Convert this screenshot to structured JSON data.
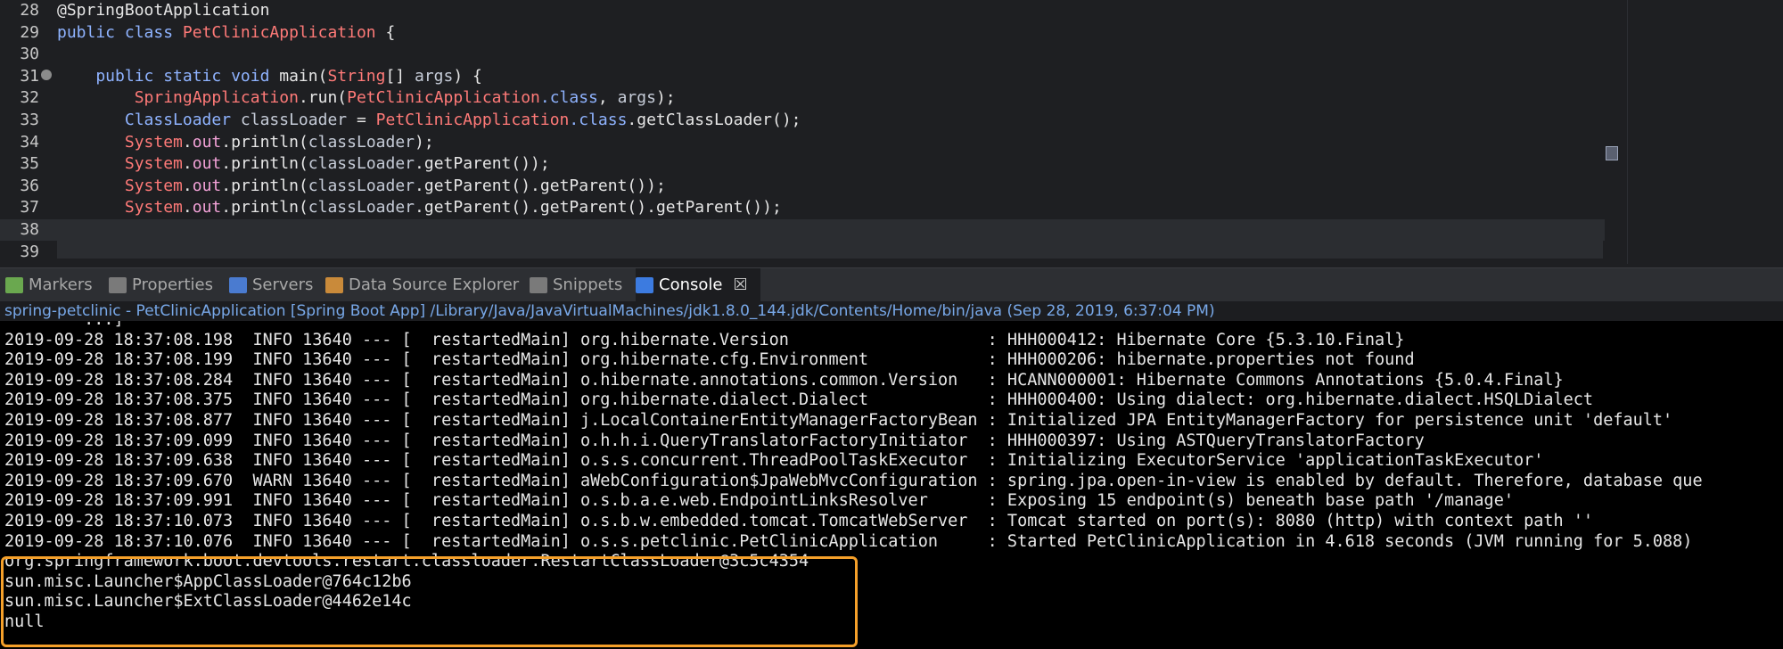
{
  "editor": {
    "lines": [
      {
        "num": "28",
        "segments": [
          {
            "t": "@SpringBootApplication",
            "c": "plain"
          }
        ]
      },
      {
        "num": "29",
        "segments": [
          {
            "t": "public class ",
            "c": "kw"
          },
          {
            "t": "PetClinicApplication",
            "c": "type"
          },
          {
            "t": " {",
            "c": "plain"
          }
        ]
      },
      {
        "num": "30",
        "segments": []
      },
      {
        "num": "31",
        "fold": true,
        "segments": [
          {
            "t": "    public static void ",
            "c": "kw"
          },
          {
            "t": "main(",
            "c": "plain"
          },
          {
            "t": "String",
            "c": "type"
          },
          {
            "t": "[] ",
            "c": "plain"
          },
          {
            "t": "args",
            "c": "var"
          },
          {
            "t": ") {",
            "c": "plain"
          }
        ]
      },
      {
        "num": "32",
        "segments": [
          {
            "t": "        ",
            "c": "plain"
          },
          {
            "t": "SpringApplication",
            "c": "type"
          },
          {
            "t": ".run(",
            "c": "plain"
          },
          {
            "t": "PetClinicApplication",
            "c": "type"
          },
          {
            "t": ".class",
            "c": "kw"
          },
          {
            "t": ", ",
            "c": "plain"
          },
          {
            "t": "args",
            "c": "var"
          },
          {
            "t": ");",
            "c": "plain"
          }
        ]
      },
      {
        "num": "33",
        "segments": [
          {
            "t": "       ",
            "c": "plain"
          },
          {
            "t": "ClassLoader ",
            "c": "kw"
          },
          {
            "t": "classLoader",
            "c": "var"
          },
          {
            "t": " = ",
            "c": "plain"
          },
          {
            "t": "PetClinicApplication",
            "c": "type"
          },
          {
            "t": ".class",
            "c": "kw"
          },
          {
            "t": ".getClassLoader();",
            "c": "plain"
          }
        ]
      },
      {
        "num": "34",
        "segments": [
          {
            "t": "       ",
            "c": "plain"
          },
          {
            "t": "System",
            "c": "type"
          },
          {
            "t": ".",
            "c": "plain"
          },
          {
            "t": "out",
            "c": "fld"
          },
          {
            "t": ".println(",
            "c": "plain"
          },
          {
            "t": "classLoader",
            "c": "var"
          },
          {
            "t": ");",
            "c": "plain"
          }
        ]
      },
      {
        "num": "35",
        "segments": [
          {
            "t": "       ",
            "c": "plain"
          },
          {
            "t": "System",
            "c": "type"
          },
          {
            "t": ".",
            "c": "plain"
          },
          {
            "t": "out",
            "c": "fld"
          },
          {
            "t": ".println(",
            "c": "plain"
          },
          {
            "t": "classLoader",
            "c": "var"
          },
          {
            "t": ".getParent());",
            "c": "plain"
          }
        ]
      },
      {
        "num": "36",
        "segments": [
          {
            "t": "       ",
            "c": "plain"
          },
          {
            "t": "System",
            "c": "type"
          },
          {
            "t": ".",
            "c": "plain"
          },
          {
            "t": "out",
            "c": "fld"
          },
          {
            "t": ".println(",
            "c": "plain"
          },
          {
            "t": "classLoader",
            "c": "var"
          },
          {
            "t": ".getParent().getParent());",
            "c": "plain"
          }
        ]
      },
      {
        "num": "37",
        "segments": [
          {
            "t": "       ",
            "c": "plain"
          },
          {
            "t": "System",
            "c": "type"
          },
          {
            "t": ".",
            "c": "plain"
          },
          {
            "t": "out",
            "c": "fld"
          },
          {
            "t": ".println(",
            "c": "plain"
          },
          {
            "t": "classLoader",
            "c": "var"
          },
          {
            "t": ".getParent().getParent().getParent());",
            "c": "plain"
          }
        ]
      },
      {
        "num": "38",
        "current": true,
        "segments": []
      },
      {
        "num": "39",
        "segments": []
      }
    ]
  },
  "tabs": [
    {
      "label": "Markers",
      "icon": "markers-icon",
      "color": "#6aa84f"
    },
    {
      "label": "Properties",
      "icon": "properties-icon",
      "color": "#7a7a7a"
    },
    {
      "label": "Servers",
      "icon": "servers-icon",
      "color": "#4a7bd0"
    },
    {
      "label": "Data Source Explorer",
      "icon": "data-source-icon",
      "color": "#c98a3a"
    },
    {
      "label": "Snippets",
      "icon": "snippets-icon",
      "color": "#7a7a7a"
    },
    {
      "label": "Console",
      "icon": "console-icon",
      "color": "#3c7be0",
      "active": true,
      "close": "☒"
    }
  ],
  "console": {
    "path": "spring-petclinic - PetClinicApplication [Spring Boot App] /Library/Java/JavaVirtualMachines/jdk1.8.0_144.jdk/Contents/Home/bin/java (Sep 28, 2019, 6:37:04 PM)",
    "lines": [
      "        ...]",
      "2019-09-28 18:37:08.198  INFO 13640 --- [  restartedMain] org.hibernate.Version                    : HHH000412: Hibernate Core {5.3.10.Final}",
      "2019-09-28 18:37:08.199  INFO 13640 --- [  restartedMain] org.hibernate.cfg.Environment            : HHH000206: hibernate.properties not found",
      "2019-09-28 18:37:08.284  INFO 13640 --- [  restartedMain] o.hibernate.annotations.common.Version   : HCANN000001: Hibernate Commons Annotations {5.0.4.Final}",
      "2019-09-28 18:37:08.375  INFO 13640 --- [  restartedMain] org.hibernate.dialect.Dialect            : HHH000400: Using dialect: org.hibernate.dialect.HSQLDialect",
      "2019-09-28 18:37:08.877  INFO 13640 --- [  restartedMain] j.LocalContainerEntityManagerFactoryBean : Initialized JPA EntityManagerFactory for persistence unit 'default'",
      "2019-09-28 18:37:09.099  INFO 13640 --- [  restartedMain] o.h.h.i.QueryTranslatorFactoryInitiator  : HHH000397: Using ASTQueryTranslatorFactory",
      "2019-09-28 18:37:09.638  INFO 13640 --- [  restartedMain] o.s.s.concurrent.ThreadPoolTaskExecutor  : Initializing ExecutorService 'applicationTaskExecutor'",
      "2019-09-28 18:37:09.670  WARN 13640 --- [  restartedMain] aWebConfiguration$JpaWebMvcConfiguration : spring.jpa.open-in-view is enabled by default. Therefore, database que",
      "2019-09-28 18:37:09.991  INFO 13640 --- [  restartedMain] o.s.b.a.e.web.EndpointLinksResolver      : Exposing 15 endpoint(s) beneath base path '/manage'",
      "2019-09-28 18:37:10.073  INFO 13640 --- [  restartedMain] o.s.b.w.embedded.tomcat.TomcatWebServer  : Tomcat started on port(s): 8080 (http) with context path ''",
      "2019-09-28 18:37:10.076  INFO 13640 --- [  restartedMain] o.s.s.petclinic.PetClinicApplication     : Started PetClinicApplication in 4.618 seconds (JVM running for 5.088)",
      "org.springframework.boot.devtools.restart.classloader.RestartClassLoader@3c5c4354",
      "sun.misc.Launcher$AppClassLoader@764c12b6",
      "sun.misc.Launcher$ExtClassLoader@4462e14c",
      "null"
    ]
  },
  "colors": {
    "highlight": "#f5a02a"
  }
}
